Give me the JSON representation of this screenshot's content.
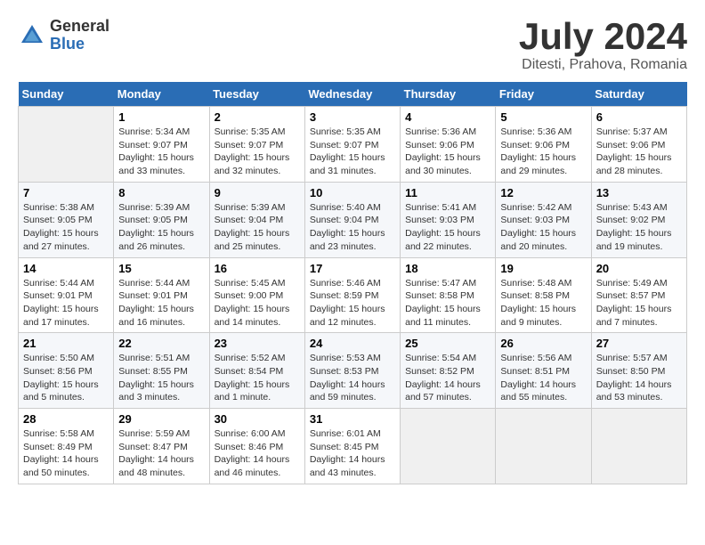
{
  "header": {
    "logo_general": "General",
    "logo_blue": "Blue",
    "month_title": "July 2024",
    "location": "Ditesti, Prahova, Romania"
  },
  "days_of_week": [
    "Sunday",
    "Monday",
    "Tuesday",
    "Wednesday",
    "Thursday",
    "Friday",
    "Saturday"
  ],
  "weeks": [
    [
      {
        "day": "",
        "info": ""
      },
      {
        "day": "1",
        "info": "Sunrise: 5:34 AM\nSunset: 9:07 PM\nDaylight: 15 hours\nand 33 minutes."
      },
      {
        "day": "2",
        "info": "Sunrise: 5:35 AM\nSunset: 9:07 PM\nDaylight: 15 hours\nand 32 minutes."
      },
      {
        "day": "3",
        "info": "Sunrise: 5:35 AM\nSunset: 9:07 PM\nDaylight: 15 hours\nand 31 minutes."
      },
      {
        "day": "4",
        "info": "Sunrise: 5:36 AM\nSunset: 9:06 PM\nDaylight: 15 hours\nand 30 minutes."
      },
      {
        "day": "5",
        "info": "Sunrise: 5:36 AM\nSunset: 9:06 PM\nDaylight: 15 hours\nand 29 minutes."
      },
      {
        "day": "6",
        "info": "Sunrise: 5:37 AM\nSunset: 9:06 PM\nDaylight: 15 hours\nand 28 minutes."
      }
    ],
    [
      {
        "day": "7",
        "info": "Sunrise: 5:38 AM\nSunset: 9:05 PM\nDaylight: 15 hours\nand 27 minutes."
      },
      {
        "day": "8",
        "info": "Sunrise: 5:39 AM\nSunset: 9:05 PM\nDaylight: 15 hours\nand 26 minutes."
      },
      {
        "day": "9",
        "info": "Sunrise: 5:39 AM\nSunset: 9:04 PM\nDaylight: 15 hours\nand 25 minutes."
      },
      {
        "day": "10",
        "info": "Sunrise: 5:40 AM\nSunset: 9:04 PM\nDaylight: 15 hours\nand 23 minutes."
      },
      {
        "day": "11",
        "info": "Sunrise: 5:41 AM\nSunset: 9:03 PM\nDaylight: 15 hours\nand 22 minutes."
      },
      {
        "day": "12",
        "info": "Sunrise: 5:42 AM\nSunset: 9:03 PM\nDaylight: 15 hours\nand 20 minutes."
      },
      {
        "day": "13",
        "info": "Sunrise: 5:43 AM\nSunset: 9:02 PM\nDaylight: 15 hours\nand 19 minutes."
      }
    ],
    [
      {
        "day": "14",
        "info": "Sunrise: 5:44 AM\nSunset: 9:01 PM\nDaylight: 15 hours\nand 17 minutes."
      },
      {
        "day": "15",
        "info": "Sunrise: 5:44 AM\nSunset: 9:01 PM\nDaylight: 15 hours\nand 16 minutes."
      },
      {
        "day": "16",
        "info": "Sunrise: 5:45 AM\nSunset: 9:00 PM\nDaylight: 15 hours\nand 14 minutes."
      },
      {
        "day": "17",
        "info": "Sunrise: 5:46 AM\nSunset: 8:59 PM\nDaylight: 15 hours\nand 12 minutes."
      },
      {
        "day": "18",
        "info": "Sunrise: 5:47 AM\nSunset: 8:58 PM\nDaylight: 15 hours\nand 11 minutes."
      },
      {
        "day": "19",
        "info": "Sunrise: 5:48 AM\nSunset: 8:58 PM\nDaylight: 15 hours\nand 9 minutes."
      },
      {
        "day": "20",
        "info": "Sunrise: 5:49 AM\nSunset: 8:57 PM\nDaylight: 15 hours\nand 7 minutes."
      }
    ],
    [
      {
        "day": "21",
        "info": "Sunrise: 5:50 AM\nSunset: 8:56 PM\nDaylight: 15 hours\nand 5 minutes."
      },
      {
        "day": "22",
        "info": "Sunrise: 5:51 AM\nSunset: 8:55 PM\nDaylight: 15 hours\nand 3 minutes."
      },
      {
        "day": "23",
        "info": "Sunrise: 5:52 AM\nSunset: 8:54 PM\nDaylight: 15 hours\nand 1 minute."
      },
      {
        "day": "24",
        "info": "Sunrise: 5:53 AM\nSunset: 8:53 PM\nDaylight: 14 hours\nand 59 minutes."
      },
      {
        "day": "25",
        "info": "Sunrise: 5:54 AM\nSunset: 8:52 PM\nDaylight: 14 hours\nand 57 minutes."
      },
      {
        "day": "26",
        "info": "Sunrise: 5:56 AM\nSunset: 8:51 PM\nDaylight: 14 hours\nand 55 minutes."
      },
      {
        "day": "27",
        "info": "Sunrise: 5:57 AM\nSunset: 8:50 PM\nDaylight: 14 hours\nand 53 minutes."
      }
    ],
    [
      {
        "day": "28",
        "info": "Sunrise: 5:58 AM\nSunset: 8:49 PM\nDaylight: 14 hours\nand 50 minutes."
      },
      {
        "day": "29",
        "info": "Sunrise: 5:59 AM\nSunset: 8:47 PM\nDaylight: 14 hours\nand 48 minutes."
      },
      {
        "day": "30",
        "info": "Sunrise: 6:00 AM\nSunset: 8:46 PM\nDaylight: 14 hours\nand 46 minutes."
      },
      {
        "day": "31",
        "info": "Sunrise: 6:01 AM\nSunset: 8:45 PM\nDaylight: 14 hours\nand 43 minutes."
      },
      {
        "day": "",
        "info": ""
      },
      {
        "day": "",
        "info": ""
      },
      {
        "day": "",
        "info": ""
      }
    ]
  ]
}
